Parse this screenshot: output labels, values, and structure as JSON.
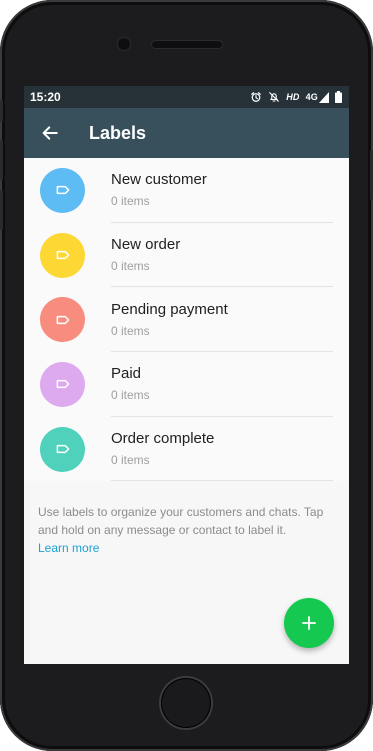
{
  "status_bar": {
    "time": "15:20",
    "network_text": "HD",
    "signal_text": "4G",
    "icons": [
      "alarm-icon",
      "notifications-off-icon",
      "signal-icon",
      "battery-icon"
    ]
  },
  "app_bar": {
    "title": "Labels",
    "back_icon": "arrow-back-icon"
  },
  "labels": [
    {
      "name": "New customer",
      "count": "0 items",
      "color": "#5ebcf4"
    },
    {
      "name": "New order",
      "count": "0 items",
      "color": "#fdd835"
    },
    {
      "name": "Pending payment",
      "count": "0 items",
      "color": "#f88c7f"
    },
    {
      "name": "Paid",
      "count": "0 items",
      "color": "#dda9ef"
    },
    {
      "name": "Order complete",
      "count": "0 items",
      "color": "#4fd1bb"
    }
  ],
  "info": {
    "text": "Use labels to organize your customers and chats. Tap and hold on any message or contact to label it.",
    "link": "Learn more"
  },
  "fab": {
    "icon": "plus-icon"
  },
  "colors": {
    "status_bar": "#263238",
    "app_bar": "#37505c",
    "fab": "#15c850",
    "link": "#1aa3d6"
  }
}
